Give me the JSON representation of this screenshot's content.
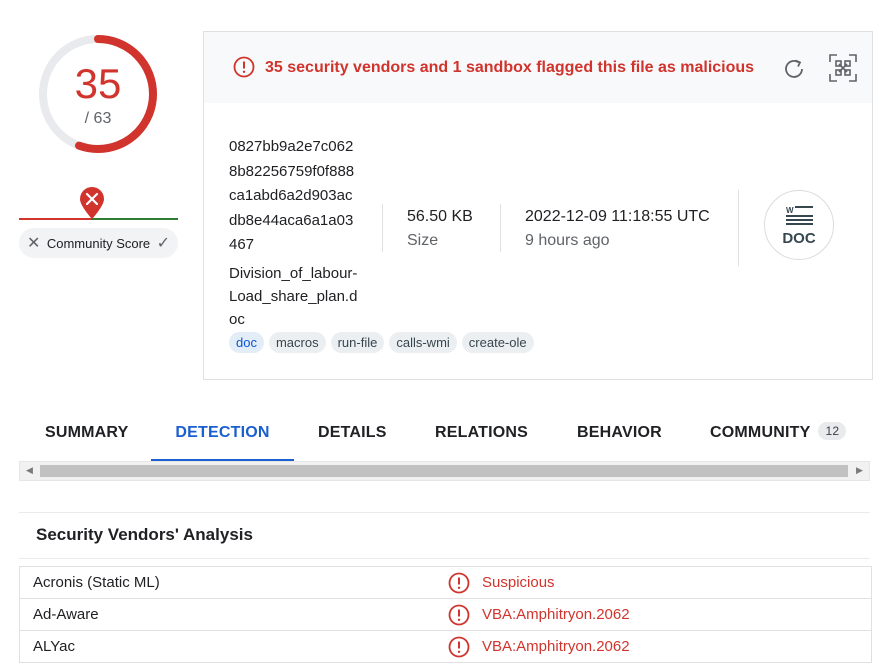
{
  "score": {
    "detections": "35",
    "total": "/ 63",
    "detected_fraction": 0.5556
  },
  "community": {
    "label": "Community Score",
    "negative_fraction": 0.45
  },
  "alert": {
    "text": "35 security vendors and 1 sandbox flagged this file as malicious"
  },
  "file": {
    "hash": "0827bb9a2e7c0628b82256759f0f888ca1abd6a2d903acdb8e44aca6a1a03467",
    "name": "Division_of_labour-Load_share_plan.doc",
    "size": "56.50 KB",
    "size_label": "Size",
    "date": "2022-12-09 11:18:55 UTC",
    "date_relative": "9 hours ago",
    "type_icon": "DOC"
  },
  "tags": [
    "doc",
    "macros",
    "run-file",
    "calls-wmi",
    "create-ole"
  ],
  "tabs": {
    "summary": "SUMMARY",
    "detection": "DETECTION",
    "details": "DETAILS",
    "relations": "RELATIONS",
    "behavior": "BEHAVIOR",
    "community": "COMMUNITY",
    "community_count": "12",
    "active": "detection"
  },
  "vendors": {
    "title": "Security Vendors' Analysis",
    "rows": [
      {
        "vendor": "Acronis (Static ML)",
        "result": "Suspicious"
      },
      {
        "vendor": "Ad-Aware",
        "result": "VBA:Amphitryon.2062"
      },
      {
        "vendor": "ALYac",
        "result": "VBA:Amphitryon.2062"
      }
    ]
  },
  "colors": {
    "malicious": "#d0342c",
    "accent": "#1a5fd0",
    "harmless": "#2e7d32"
  }
}
